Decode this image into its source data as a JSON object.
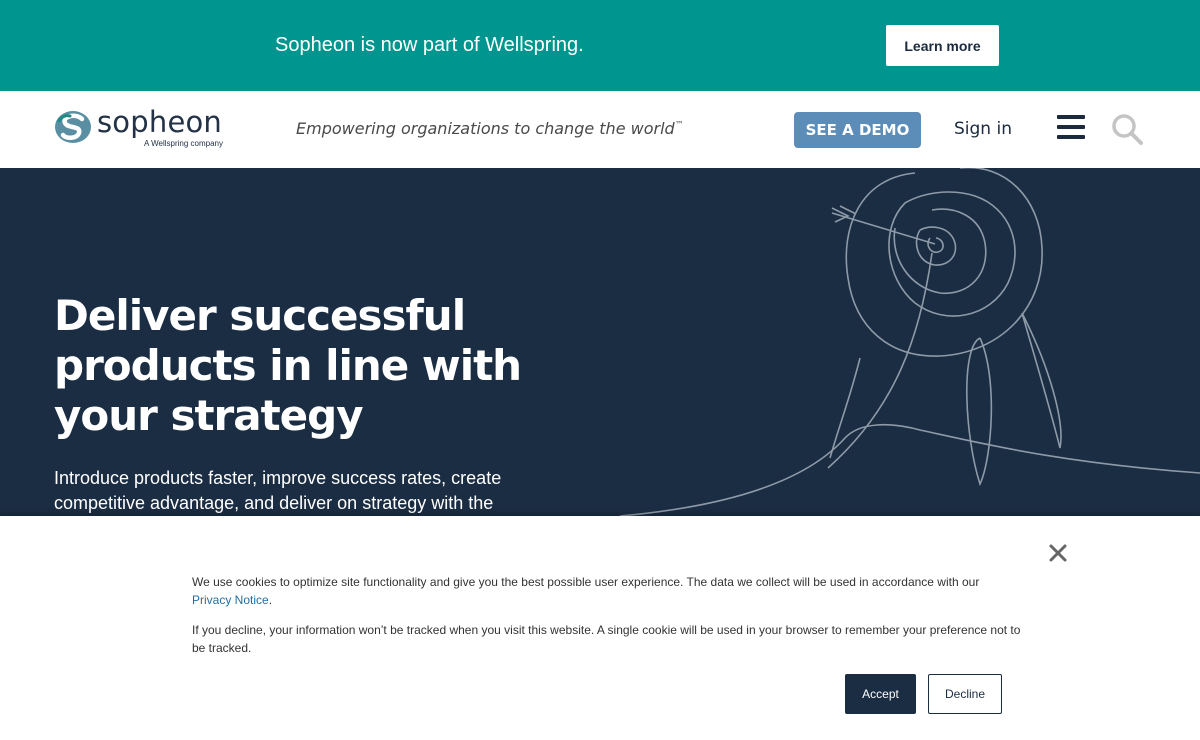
{
  "announcement": {
    "text": "Sopheon is now part of Wellspring.",
    "button_label": "Learn more"
  },
  "header": {
    "logo_word": "sopheon",
    "logo_subtext": "A Wellspring company",
    "tagline": "Empowering organizations to change the world",
    "tagline_mark": "™",
    "demo_label": "SEE A DEMO",
    "signin_label": "Sign in",
    "menu_icon": "hamburger-icon",
    "search_icon": "search-icon"
  },
  "hero": {
    "title": "Deliver successful products in line with your strategy",
    "subtitle": "Introduce products faster, improve success rates, create competitive advantage, and deliver on strategy with the",
    "illustration": "target-arrow-line-art"
  },
  "cookie": {
    "p1_text": "We use cookies to optimize site functionality and give you the best possible user experience. The data we collect will be used in accordance with our",
    "privacy_link": "Privacy Notice",
    "p1_end": ".",
    "p2_text": "If you decline, your information won’t be tracked when you visit this website. A single cookie will be used in your browser to remember your preference not to be tracked.",
    "accept_label": "Accept",
    "decline_label": "Decline",
    "close_icon": "close-icon"
  },
  "colors": {
    "announcement_bg": "#00968f",
    "hero_bg": "#1b2d43",
    "demo_button": "#5b8db8",
    "brand_dark": "#1b2a3d"
  }
}
